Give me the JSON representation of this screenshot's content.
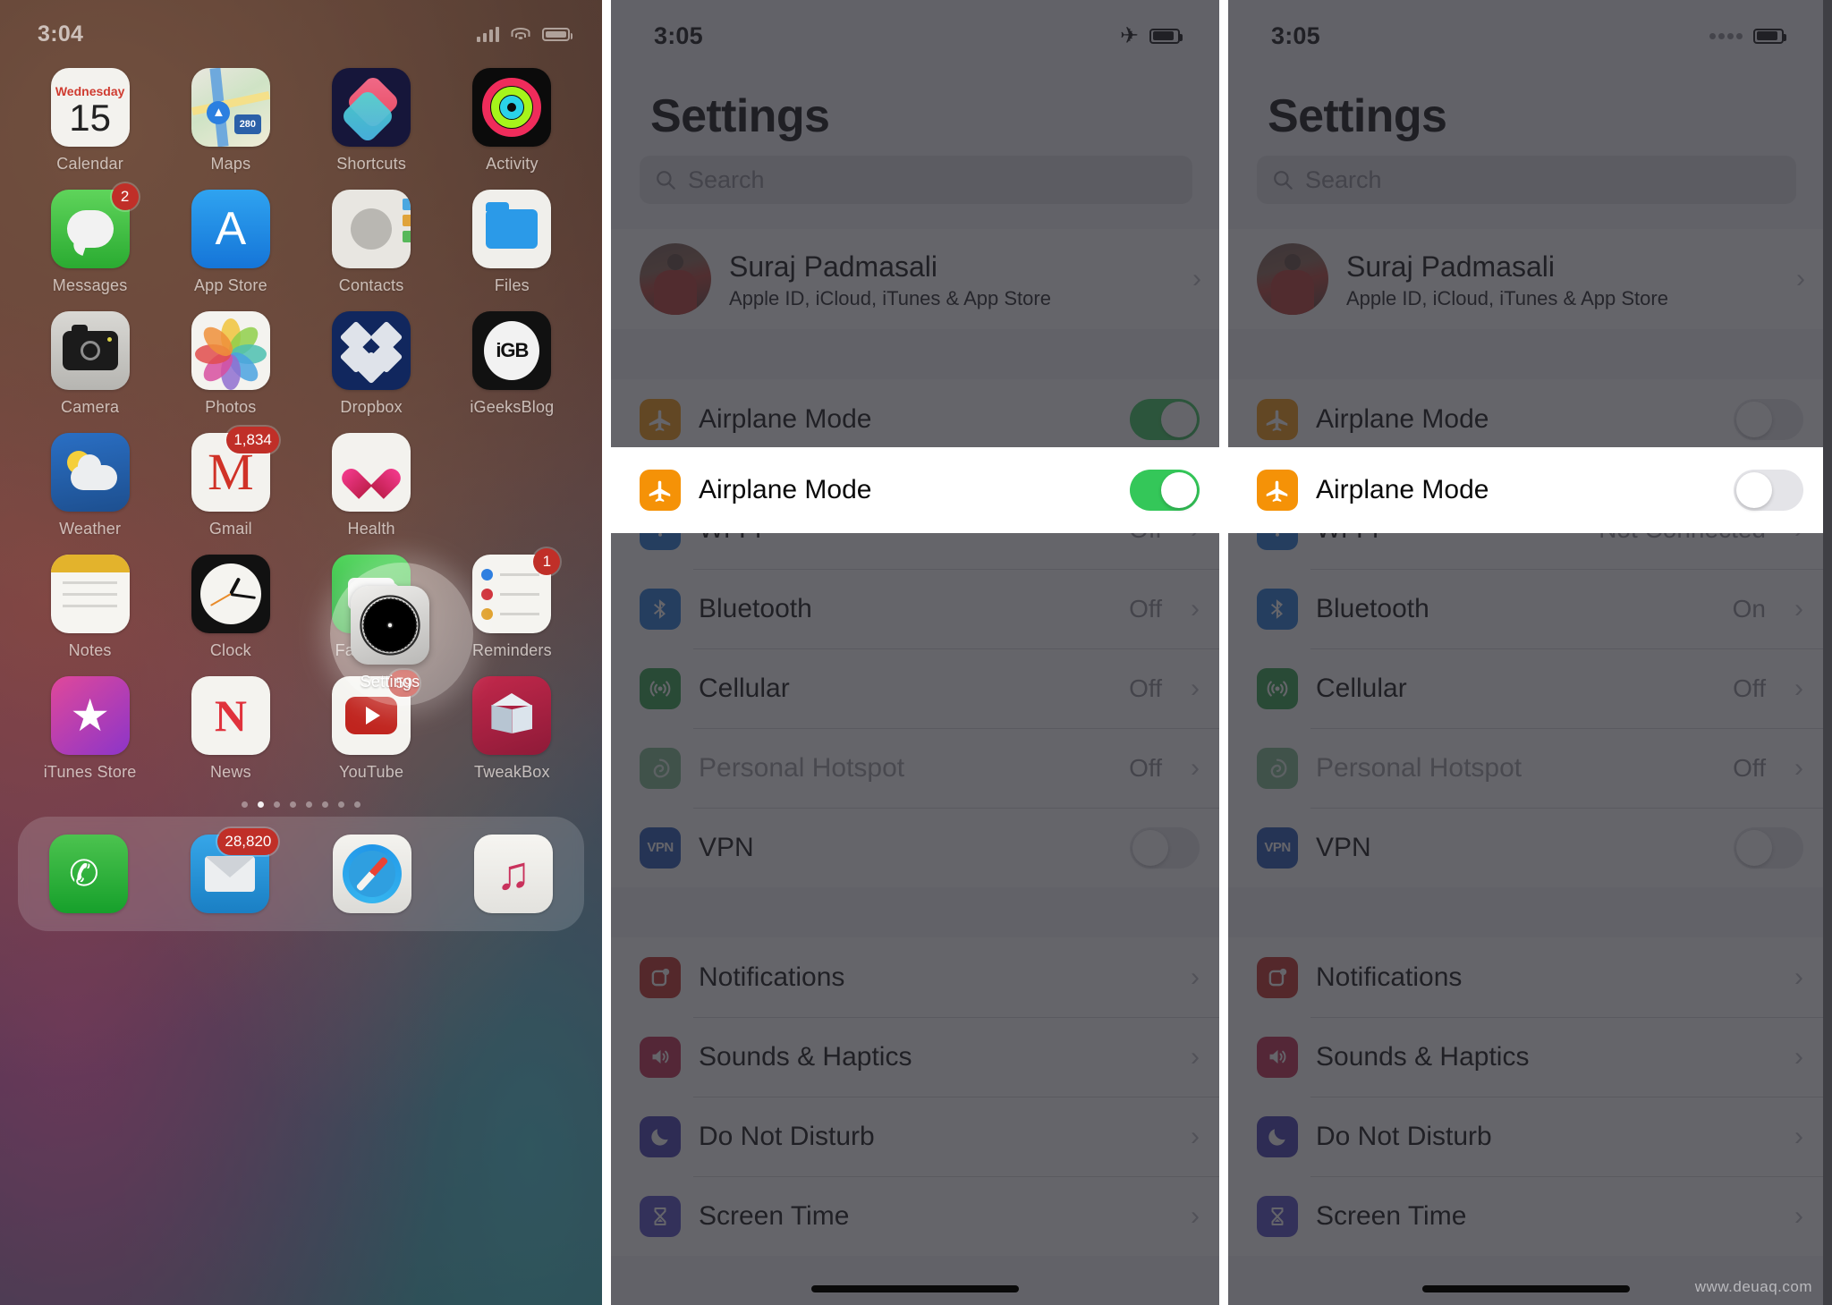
{
  "home_screen": {
    "status_bar": {
      "time": "3:04",
      "signal_icon": "cellular-bars-icon",
      "wifi_icon": "wifi-icon",
      "battery_icon": "battery-icon"
    },
    "rows": [
      [
        {
          "label": "Calendar",
          "icon": "calendar-icon",
          "day_name": "Wednesday",
          "day_number": "15",
          "badge": null
        },
        {
          "label": "Maps",
          "icon": "maps-icon",
          "shield_text": "280",
          "badge": null
        },
        {
          "label": "Shortcuts",
          "icon": "shortcuts-icon",
          "badge": null
        },
        {
          "label": "Activity",
          "icon": "activity-rings-icon",
          "badge": null
        }
      ],
      [
        {
          "label": "Messages",
          "icon": "messages-icon",
          "badge": "2"
        },
        {
          "label": "App Store",
          "icon": "app-store-icon",
          "badge": null
        },
        {
          "label": "Contacts",
          "icon": "contacts-icon",
          "badge": null
        },
        {
          "label": "Files",
          "icon": "files-icon",
          "badge": null
        }
      ],
      [
        {
          "label": "Camera",
          "icon": "camera-icon",
          "badge": null
        },
        {
          "label": "Photos",
          "icon": "photos-icon",
          "badge": null
        },
        {
          "label": "Dropbox",
          "icon": "dropbox-icon",
          "badge": null
        },
        {
          "label": "iGeeksBlog",
          "icon": "igeeksblog-icon",
          "logo_text": "iGB",
          "badge": null
        }
      ],
      [
        {
          "label": "Weather",
          "icon": "weather-icon",
          "badge": null
        },
        {
          "label": "Gmail",
          "icon": "gmail-icon",
          "logo_text": "M",
          "badge": "1,834"
        },
        {
          "label": "Health",
          "icon": "health-heart-icon",
          "badge": null
        },
        {
          "label": "Settings",
          "icon": "settings-gear-icon",
          "badge": null
        }
      ],
      [
        {
          "label": "Notes",
          "icon": "notes-icon",
          "badge": null
        },
        {
          "label": "Clock",
          "icon": "clock-icon",
          "badge": null
        },
        {
          "label": "FaceTime",
          "icon": "facetime-icon",
          "badge": null
        },
        {
          "label": "Reminders",
          "icon": "reminders-icon",
          "badge": "1"
        }
      ],
      [
        {
          "label": "iTunes Store",
          "icon": "itunes-store-icon",
          "badge": null
        },
        {
          "label": "News",
          "icon": "news-icon",
          "logo_text": "N",
          "badge": null
        },
        {
          "label": "YouTube",
          "icon": "youtube-icon",
          "badge": "59"
        },
        {
          "label": "TweakBox",
          "icon": "tweakbox-icon",
          "badge": null
        }
      ]
    ],
    "highlight": {
      "target_label": "Settings",
      "shape": "circle-spotlight"
    },
    "page_dots": {
      "count": 8,
      "active_index": 1
    },
    "dock": [
      {
        "label": "Phone",
        "icon": "phone-icon",
        "badge": null
      },
      {
        "label": "Mail",
        "icon": "mail-icon",
        "badge": "28,820"
      },
      {
        "label": "Safari",
        "icon": "safari-compass-icon",
        "badge": null
      },
      {
        "label": "Music",
        "icon": "music-note-icon",
        "badge": null
      }
    ]
  },
  "settings_before": {
    "status_bar": {
      "time": "3:05",
      "airplane_icon": "airplane-icon",
      "battery_icon": "battery-icon"
    },
    "title": "Settings",
    "search": {
      "placeholder": "Search",
      "icon": "search-icon"
    },
    "account": {
      "name": "Suraj Padmasali",
      "subtitle": "Apple ID, iCloud, iTunes & App Store",
      "avatar": "user-avatar",
      "chevron": "chevron-right-icon"
    },
    "airplane_row": {
      "label": "Airplane Mode",
      "icon": "airplane-icon",
      "toggle_state": "on"
    },
    "connectivity": [
      {
        "label": "Wi-Fi",
        "icon": "wifi-icon",
        "value": "Off",
        "control": "chevron",
        "disabled": false
      },
      {
        "label": "Bluetooth",
        "icon": "bluetooth-icon",
        "value": "Off",
        "control": "chevron",
        "disabled": false
      },
      {
        "label": "Cellular",
        "icon": "cellular-icon",
        "value": "Off",
        "control": "chevron",
        "disabled": false
      },
      {
        "label": "Personal Hotspot",
        "icon": "hotspot-icon",
        "value": "Off",
        "control": "chevron",
        "disabled": true
      },
      {
        "label": "VPN",
        "icon": "vpn-icon",
        "value": "",
        "control": "toggle-off",
        "disabled": false
      }
    ],
    "system": [
      {
        "label": "Notifications",
        "icon": "notifications-icon",
        "control": "chevron"
      },
      {
        "label": "Sounds & Haptics",
        "icon": "sounds-icon",
        "control": "chevron"
      },
      {
        "label": "Do Not Disturb",
        "icon": "moon-icon",
        "control": "chevron"
      },
      {
        "label": "Screen Time",
        "icon": "hourglass-icon",
        "control": "chevron"
      }
    ]
  },
  "settings_after": {
    "status_bar": {
      "time": "3:05",
      "signal_icon": "cellular-dots-icon",
      "battery_icon": "battery-icon"
    },
    "title": "Settings",
    "search": {
      "placeholder": "Search",
      "icon": "search-icon"
    },
    "account": {
      "name": "Suraj Padmasali",
      "subtitle": "Apple ID, iCloud, iTunes & App Store",
      "avatar": "user-avatar",
      "chevron": "chevron-right-icon"
    },
    "airplane_row": {
      "label": "Airplane Mode",
      "icon": "airplane-icon",
      "toggle_state": "off"
    },
    "connectivity": [
      {
        "label": "Wi-Fi",
        "icon": "wifi-icon",
        "value": "Not Connected",
        "control": "chevron",
        "disabled": false
      },
      {
        "label": "Bluetooth",
        "icon": "bluetooth-icon",
        "value": "On",
        "control": "chevron",
        "disabled": false
      },
      {
        "label": "Cellular",
        "icon": "cellular-icon",
        "value": "Off",
        "control": "chevron",
        "disabled": false
      },
      {
        "label": "Personal Hotspot",
        "icon": "hotspot-icon",
        "value": "Off",
        "control": "chevron",
        "disabled": true
      },
      {
        "label": "VPN",
        "icon": "vpn-icon",
        "value": "",
        "control": "toggle-off",
        "disabled": false
      }
    ],
    "system": [
      {
        "label": "Notifications",
        "icon": "notifications-icon",
        "control": "chevron"
      },
      {
        "label": "Sounds & Haptics",
        "icon": "sounds-icon",
        "control": "chevron"
      },
      {
        "label": "Do Not Disturb",
        "icon": "moon-icon",
        "control": "chevron"
      },
      {
        "label": "Screen Time",
        "icon": "hourglass-icon",
        "control": "chevron"
      }
    ]
  },
  "watermark": "www.deuaq.com",
  "colors": {
    "accent_green": "#34c759",
    "airplane_orange": "#f59207",
    "wifi_blue": "#1a72d8",
    "cellular_green": "#2a9e45",
    "vpn_blue": "#1c4fb5",
    "notifications_red": "#c0271f",
    "sounds_red": "#c0214a",
    "dnd_indigo": "#3b33b0",
    "screentime_indigo": "#4b45c4",
    "badge_red": "#c02f28"
  }
}
